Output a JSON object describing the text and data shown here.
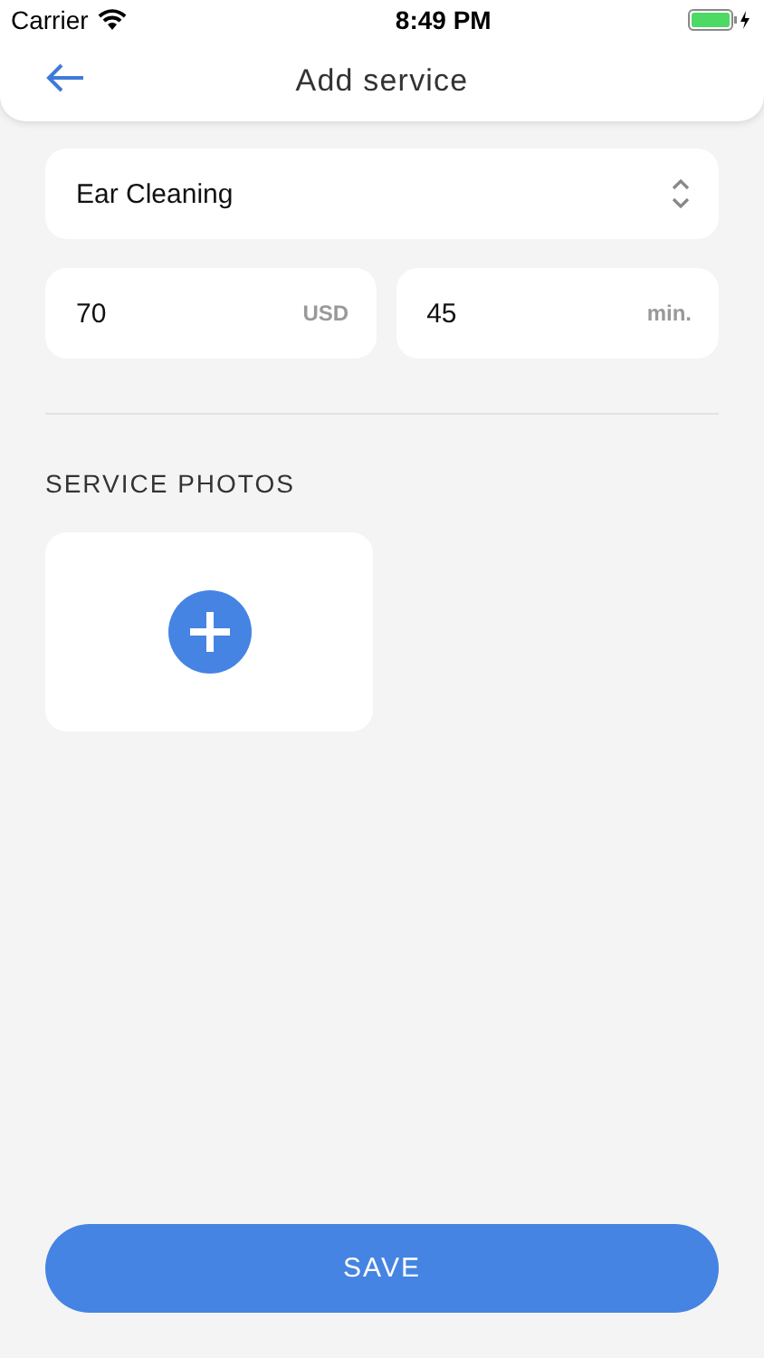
{
  "status_bar": {
    "carrier": "Carrier",
    "time": "8:49 PM"
  },
  "header": {
    "title": "Add service"
  },
  "service_select": {
    "value": "Ear Cleaning"
  },
  "price_field": {
    "value": "70",
    "unit": "USD"
  },
  "duration_field": {
    "value": "45",
    "unit": "min."
  },
  "photos": {
    "heading": "SERVICE PHOTOS"
  },
  "save_button": {
    "label": "SAVE"
  }
}
